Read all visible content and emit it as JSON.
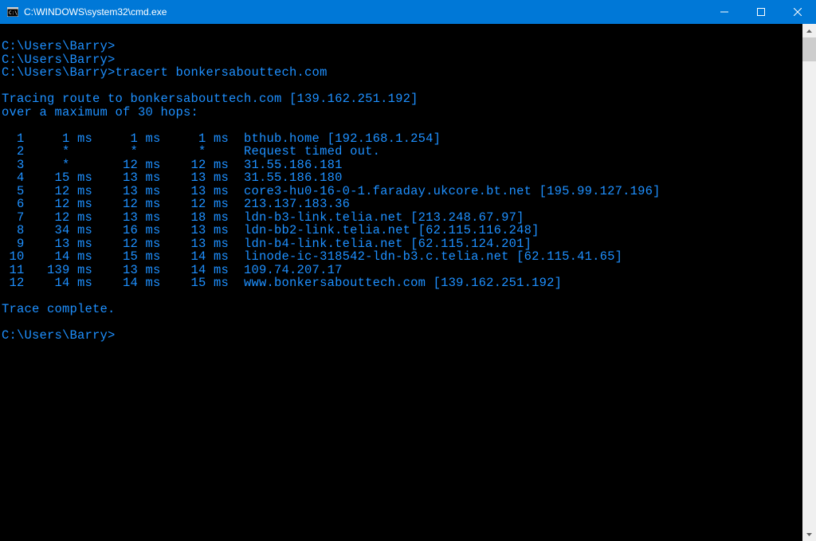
{
  "titlebar": {
    "title": "C:\\WINDOWS\\system32\\cmd.exe"
  },
  "terminal": {
    "lines": {
      "l0": "C:\\Users\\Barry>",
      "l1": "C:\\Users\\Barry>",
      "l2": "C:\\Users\\Barry>tracert bonkersabouttech.com",
      "l3": "",
      "l4": "Tracing route to bonkersabouttech.com [139.162.251.192]",
      "l5": "over a maximum of 30 hops:",
      "l6": "",
      "l7": "  1     1 ms     1 ms     1 ms  bthub.home [192.168.1.254]",
      "l8": "  2     *        *        *     Request timed out.",
      "l9": "  3     *       12 ms    12 ms  31.55.186.181",
      "l10": "  4    15 ms    13 ms    13 ms  31.55.186.180",
      "l11": "  5    12 ms    13 ms    13 ms  core3-hu0-16-0-1.faraday.ukcore.bt.net [195.99.127.196]",
      "l12": "  6    12 ms    12 ms    12 ms  213.137.183.36",
      "l13": "  7    12 ms    13 ms    18 ms  ldn-b3-link.telia.net [213.248.67.97]",
      "l14": "  8    34 ms    16 ms    13 ms  ldn-bb2-link.telia.net [62.115.116.248]",
      "l15": "  9    13 ms    12 ms    13 ms  ldn-b4-link.telia.net [62.115.124.201]",
      "l16": " 10    14 ms    15 ms    14 ms  linode-ic-318542-ldn-b3.c.telia.net [62.115.41.65]",
      "l17": " 11   139 ms    13 ms    14 ms  109.74.207.17",
      "l18": " 12    14 ms    14 ms    15 ms  www.bonkersabouttech.com [139.162.251.192]",
      "l19": "",
      "l20": "Trace complete.",
      "l21": "",
      "l22": "C:\\Users\\Barry>"
    }
  }
}
